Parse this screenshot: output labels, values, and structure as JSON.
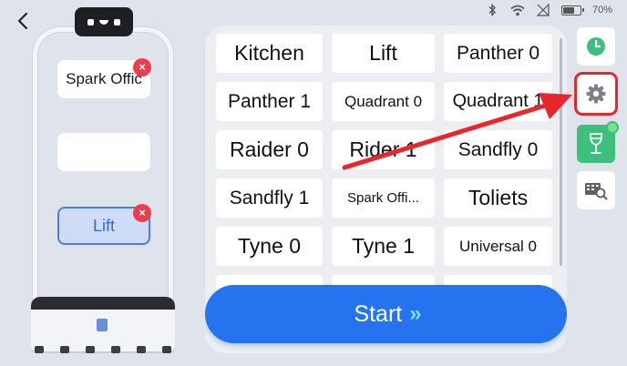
{
  "status_bar": {
    "icons": [
      "bluetooth-icon",
      "wifi-icon",
      "signal-off-icon",
      "battery-icon"
    ],
    "battery_level": 0.7,
    "battery_text": "70%"
  },
  "header": {
    "back_icon": "chevron-left-icon"
  },
  "robot": {
    "trays": [
      {
        "label": "Spark Offic",
        "has_clear": true,
        "active": false
      },
      {
        "label": "",
        "has_clear": false,
        "active": false
      },
      {
        "label": "Lift",
        "has_clear": true,
        "active": true
      }
    ],
    "clear_glyph": "×"
  },
  "destinations": [
    "Kitchen",
    "Lift",
    "Panther 0",
    "Panther 1",
    "Quadrant 0",
    "Quadrant 1",
    "Raider 0",
    "Rider 1",
    "Sandfly 0",
    "Sandfly 1",
    "Spark Offi...",
    "Toliets",
    "Tyne 0",
    "Tyne 1",
    "Universal 0",
    "",
    "",
    ""
  ],
  "start_button": {
    "label": "Start",
    "chevron": "»"
  },
  "toolbar": {
    "items": [
      "clock-icon",
      "gear-icon",
      "wine-glass-icon",
      "map-search-icon"
    ],
    "highlighted": "gear-icon"
  },
  "colors": {
    "accent": "#2573ee",
    "annotation": "#e8262c",
    "green": "#3fbf7e",
    "clear": "#ea3e4b"
  }
}
